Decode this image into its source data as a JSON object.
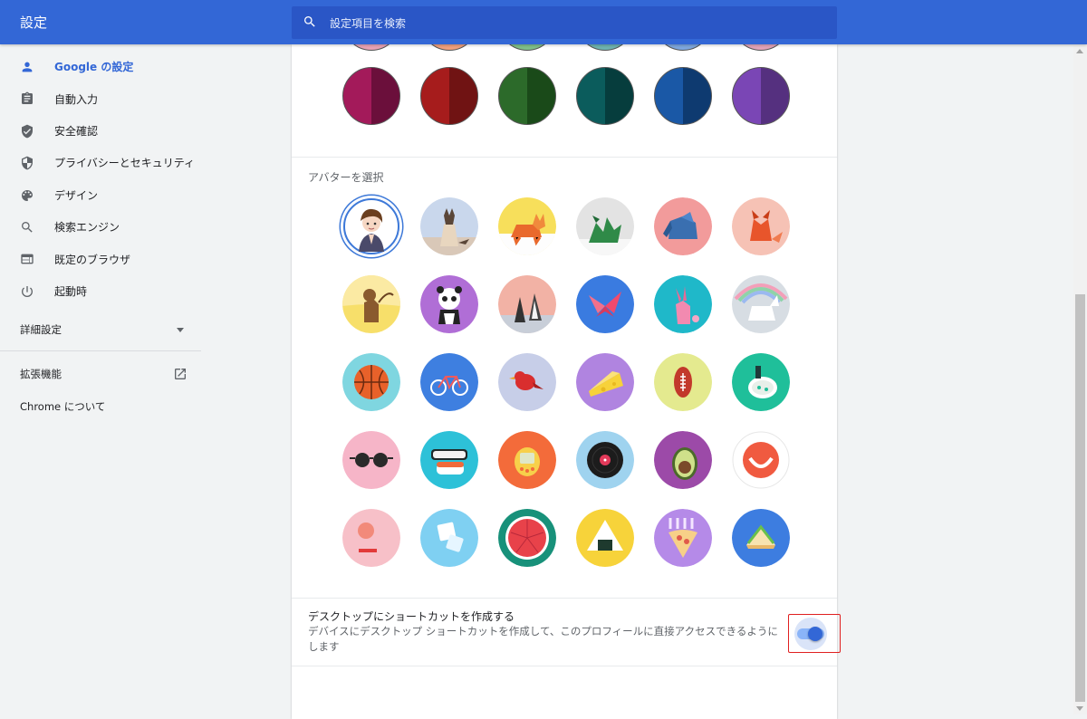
{
  "app": {
    "title": "設定"
  },
  "search": {
    "placeholder": "設定項目を検索"
  },
  "sidebar": {
    "items": [
      {
        "label": "Google の設定",
        "icon": "person-icon",
        "active": true
      },
      {
        "label": "自動入力",
        "icon": "clipboard-icon"
      },
      {
        "label": "安全確認",
        "icon": "shield-check-icon"
      },
      {
        "label": "プライバシーとセキュリティ",
        "icon": "shield-half-icon"
      },
      {
        "label": "デザイン",
        "icon": "palette-icon"
      },
      {
        "label": "検索エンジン",
        "icon": "search-icon"
      },
      {
        "label": "既定のブラウザ",
        "icon": "browser-window-icon"
      },
      {
        "label": "起動時",
        "icon": "power-icon"
      }
    ],
    "advanced_label": "詳細設定",
    "extensions_label": "拡張機能",
    "about_label": "Chrome について"
  },
  "colors": [
    {
      "left": "#a31a5a",
      "right": "#6b0f3b"
    },
    {
      "left": "#a61c1c",
      "right": "#701313"
    },
    {
      "left": "#2c6a2a",
      "right": "#1a4a19"
    },
    {
      "left": "#0b5c5c",
      "right": "#063d3d"
    },
    {
      "left": "#1a58a6",
      "right": "#0e3a70"
    },
    {
      "left": "#7a46b5",
      "right": "#55307f"
    }
  ],
  "avatar_section": {
    "heading": "アバターを選択",
    "avatars": [
      "custom-photo-avatar",
      "origami-cat-avatar",
      "origami-corgi-avatar",
      "origami-dragon-avatar",
      "origami-elephant-avatar",
      "origami-fox-avatar",
      "origami-monkey-avatar",
      "origami-panda-avatar",
      "origami-penguin-avatar",
      "origami-butterfly-avatar",
      "origami-rabbit-avatar",
      "origami-unicorn-avatar",
      "basketball-avatar",
      "bike-avatar",
      "bird-avatar",
      "cheese-avatar",
      "football-avatar",
      "ramen-avatar",
      "sunglasses-avatar",
      "sushi-avatar",
      "tamagotchi-avatar",
      "vinyl-avatar",
      "avocado-avatar",
      "smiley-avatar",
      "ice-cream-avatar",
      "ice-cube-avatar",
      "watermelon-avatar",
      "onigiri-avatar",
      "pizza-avatar",
      "sandwich-avatar"
    ],
    "selected_index": 0
  },
  "shortcut": {
    "title": "デスクトップにショートカットを作成する",
    "description": "デバイスにデスクトップ ショートカットを作成して、このプロフィールに直接アクセスできるようにします",
    "enabled": true
  }
}
